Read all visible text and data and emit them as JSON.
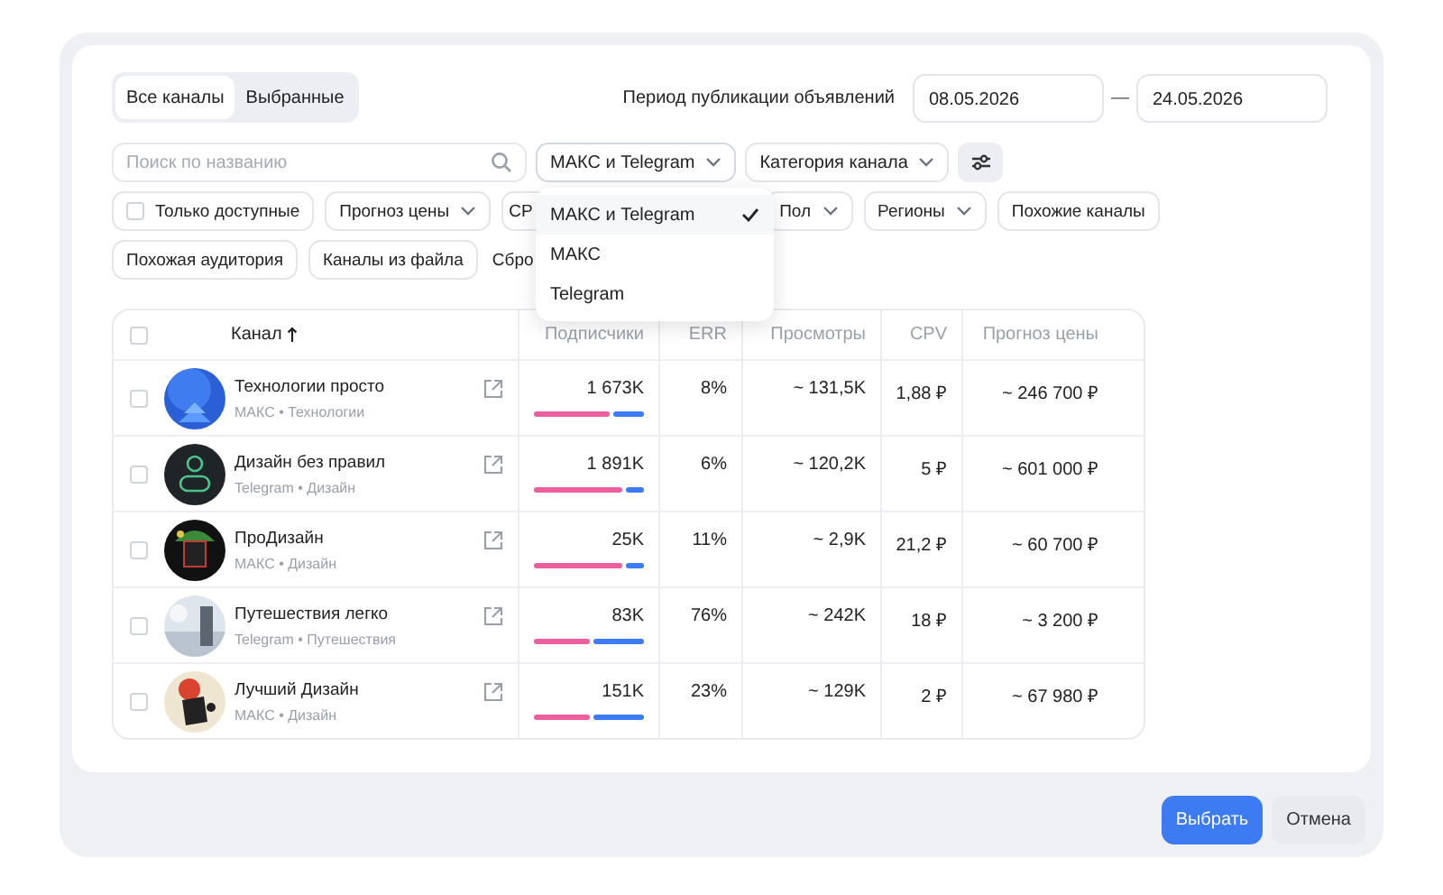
{
  "view_toggle": [
    {
      "label": "Все каналы",
      "selected": true
    },
    {
      "label": "Выбранные",
      "selected": false
    }
  ],
  "period": {
    "label": "Период публикации объявлений",
    "from": "08.05.2026",
    "separator": "—",
    "to": "24.05.2026"
  },
  "search": {
    "placeholder": "Поиск по названию"
  },
  "platform_select": {
    "value": "МАКС и Telegram",
    "expanded": true,
    "options": [
      {
        "label": "МАКС и Telegram",
        "selected": true
      },
      {
        "label": "МАКС",
        "selected": false
      },
      {
        "label": "Telegram",
        "selected": false
      }
    ]
  },
  "category_select": {
    "value": "Категория канала"
  },
  "filter_rows": [
    {
      "items": [
        {
          "kind": "checkbox",
          "label": "Только доступные",
          "checked": false
        },
        {
          "kind": "dropdown",
          "label": "Прогноз цены"
        },
        {
          "kind": "hidden",
          "label": "CP"
        },
        {
          "kind": "dropdown",
          "label": "Пол"
        },
        {
          "kind": "dropdown",
          "label": "Регионы"
        },
        {
          "kind": "chip",
          "label": "Похожие каналы"
        }
      ]
    },
    {
      "items": [
        {
          "kind": "chip",
          "label": "Похожая аудитория"
        },
        {
          "kind": "chip",
          "label": "Каналы из файла"
        },
        {
          "kind": "link",
          "label": "Сбро"
        }
      ]
    }
  ],
  "table": {
    "select_all": {
      "checked": false
    },
    "columns": [
      {
        "label": "Канал",
        "sorted": true
      },
      {
        "label": "Подписчики",
        "sorted": false
      },
      {
        "label": "ERR",
        "sorted": false
      },
      {
        "label": "Просмотры",
        "sorted": false
      },
      {
        "label": "CPV",
        "sorted": false
      },
      {
        "label": "Прогноз цены",
        "sorted": false
      }
    ],
    "rows": [
      {
        "checked": false,
        "name": "Технологии просто",
        "meta": "МАКС • Технологии",
        "subscribers": "1 673K",
        "level": 0.69,
        "err": "8%",
        "views": "~ 131,5K",
        "cpv": "1,88 ₽",
        "forecast": "~ 246 700 ₽"
      },
      {
        "checked": false,
        "name": "Дизайн без правил",
        "meta": "Telegram • Дизайн",
        "subscribers": "1 891K",
        "level": 0.8,
        "err": "6%",
        "views": "~ 120,2K",
        "cpv": "5 ₽",
        "forecast": "~ 601 000 ₽"
      },
      {
        "checked": false,
        "name": "ПроДизайн",
        "meta": "МАКС • Дизайн",
        "subscribers": "25K",
        "level": 0.8,
        "err": "11%",
        "views": "~ 2,9K",
        "cpv": "21,2 ₽",
        "forecast": "~ 60 700 ₽"
      },
      {
        "checked": false,
        "name": "Путешествия легко",
        "meta": "Telegram • Путешествия",
        "subscribers": "83K",
        "level": 0.5,
        "err": "76%",
        "views": "~ 242K",
        "cpv": "18 ₽",
        "forecast": "~ 3 200 ₽"
      },
      {
        "checked": false,
        "name": "Лучший Дизайн",
        "meta": "МАКС • Дизайн",
        "subscribers": "151K",
        "level": 0.5,
        "err": "23%",
        "views": "~ 129K",
        "cpv": "2 ₽",
        "forecast": "~ 67 980 ₽"
      }
    ]
  },
  "buttons": [
    {
      "label": "Выбрать",
      "kind": "primary"
    },
    {
      "label": "Отмена",
      "kind": "secondary"
    }
  ]
}
